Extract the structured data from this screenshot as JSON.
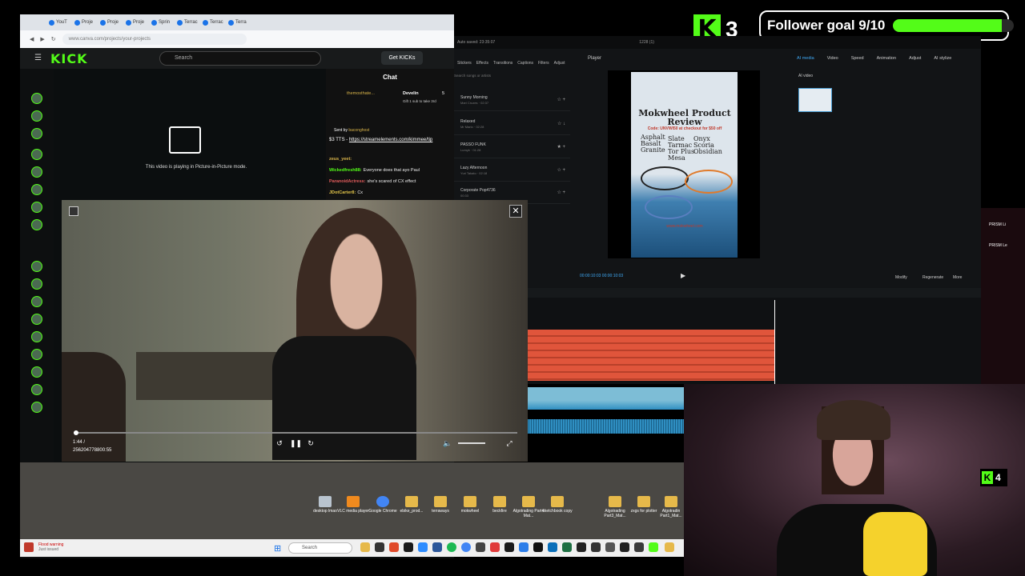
{
  "overlay": {
    "kick_count": "3",
    "follower_goal": "Follower goal 9/10",
    "goal_fraction": 0.9,
    "kick_count_small": "4"
  },
  "browser": {
    "tabs": [
      "YouT",
      "Proje",
      "Proje",
      "Proje",
      "Sprin",
      "Terrac",
      "Terrac",
      "Terra"
    ],
    "url": "www.canva.com/projects/your-projects"
  },
  "kick": {
    "logo": "KICK",
    "search_placeholder": "Search",
    "get_kicks": "Get KICKs",
    "pip_message": "This video is playing in Picture-in-Picture mode."
  },
  "chat": {
    "title": "Chat",
    "pinned_user": "themosthate...",
    "pinned_user2": "Develin",
    "pinned_count": "5",
    "gift_text": "Gift 1 sub to take 3rd",
    "sent_by_label": "Sent by",
    "sent_by_user": "baconghost",
    "tts_text": "$3 TTS - ",
    "tts_link": "https://streamelements.com/kimmee/tip",
    "messages": [
      {
        "user": "zeus_yeet:",
        "text": "",
        "color": "#d9b44a"
      },
      {
        "user": "Wickedfresh88:",
        "text": "Everyone does that ayo Paul",
        "color": "#53fc18"
      },
      {
        "user": "ParanoidActress:",
        "text": "she's scared of CX effect",
        "color": "#e05b5b"
      },
      {
        "user": "JDotCarter8:",
        "text": "Cx",
        "color": "#e0c34a"
      }
    ]
  },
  "pip": {
    "elapsed": "1:44 /",
    "duration": "256204778800:55",
    "progress_fraction": 0.0
  },
  "editor": {
    "autosave": "Auto saved: 23:35:07",
    "project": "1228 (1)",
    "tool_tabs": [
      "Stickers",
      "Effects",
      "Transitions",
      "Captions",
      "Filters",
      "Adjust"
    ],
    "search_placeholder": "Search songs or artists",
    "music": [
      {
        "title": "Sunny Morning",
        "sub": "Mari Cruzes · 02:37"
      },
      {
        "title": "Relaxed",
        "sub": "Mr Mario · 02:28"
      },
      {
        "title": "PASSO FUNK",
        "sub": "Lumyk · 01:28"
      },
      {
        "title": "Lazy Afternoon",
        "sub": "Yuri Takato · 02:18"
      },
      {
        "title": "Corporate Pop4736",
        "sub": "00:33"
      }
    ],
    "player_label": "Player",
    "poster_title": "Mokwheel Product Review",
    "poster_code": "Code: UNVWI50 at checkout for $50 off",
    "poster_terms_left": "Asphalt\nBasalt\nGranite",
    "poster_terms_right": "Slate\nTarmac\nTor Plus\nMesa",
    "poster_terms_far": "Onyx\nScoria\nObsidian",
    "poster_url": "www.mokwheel.com",
    "timecode": "00:00:10:03  00:00:10:03",
    "right_tabs": [
      "AI media",
      "Video",
      "Speed",
      "Animation",
      "Adjust",
      "AI stylize"
    ],
    "ai_video_label": "AI video",
    "modify": "Modify",
    "regenerate": "Regenerate",
    "more": "More",
    "prism": "PRISM Li",
    "prism2": "PRISM Le"
  },
  "desktop": {
    "icons": [
      "desktop lmao",
      "VLC media player",
      "Google Chrome",
      "ebike_prod...",
      "terraways",
      "mokwheel",
      "beckfire",
      "Algotrading Part4 Mat...",
      "sketchbook copy",
      "Algotrading Part3_Mat...",
      "zxgs for plotter",
      "Algotradin Part1_Mat..."
    ],
    "search": "Search",
    "flood_warning": "Flood warning",
    "flood_sub": "Just issued"
  },
  "colors": {
    "kick_green": "#53fc18",
    "editor_accent": "#3fa9f5",
    "red_track": "#e0553b"
  }
}
